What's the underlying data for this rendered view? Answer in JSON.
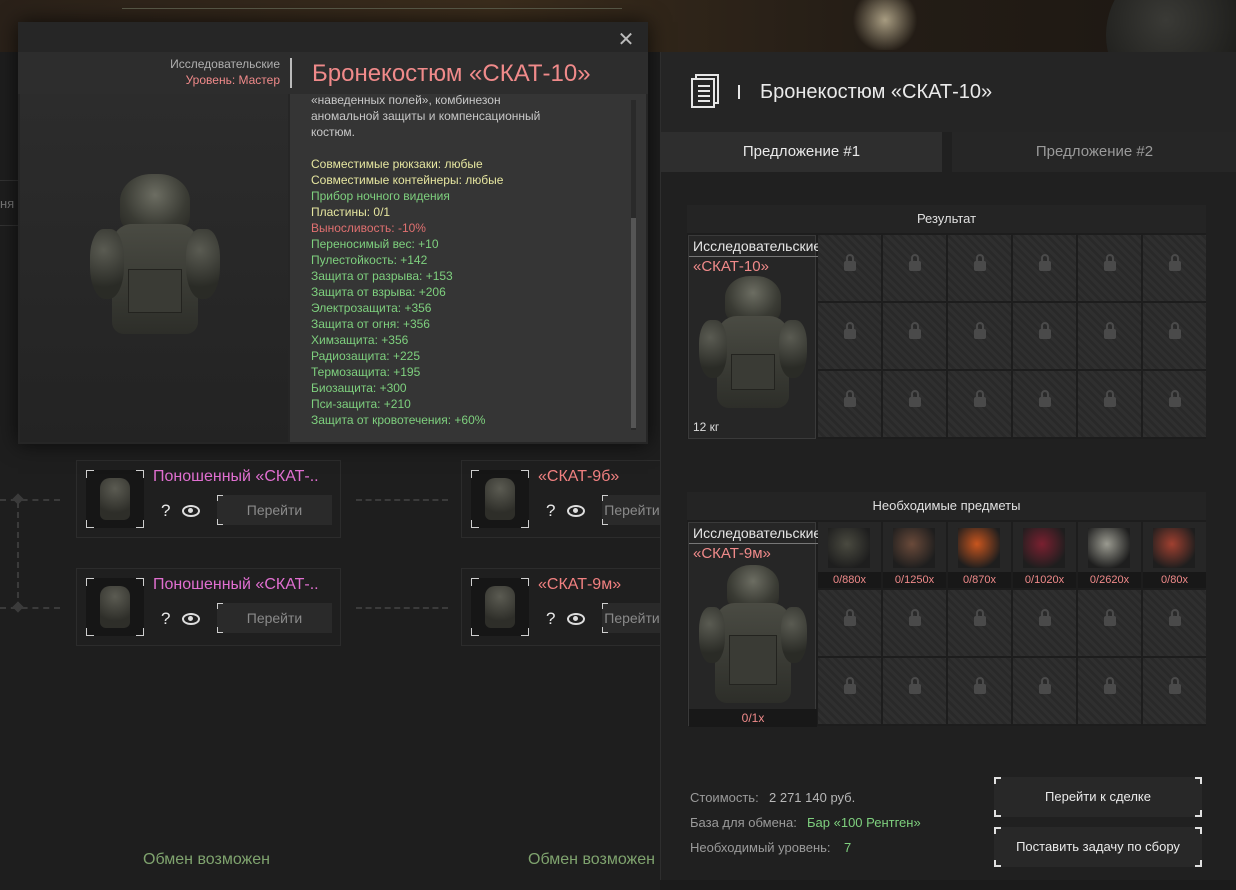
{
  "tooltip": {
    "category": "Исследовательские",
    "level": "Уровень: Мастер",
    "title": "Бронекостюм «СКАТ-10»",
    "description": [
      {
        "text": "«наведенных полей», комбинезон",
        "color": "#c8c8c8"
      },
      {
        "text": "аномальной защиты и компенсационный",
        "color": "#c8c8c8"
      },
      {
        "text": "костюм.",
        "color": "#c8c8c8"
      },
      {
        "text": "",
        "color": "#c8c8c8"
      },
      {
        "text": "Совместимые рюкзаки: любые",
        "color": "#e6e6a0"
      },
      {
        "text": "Совместимые контейнеры: любые",
        "color": "#e6e6a0"
      },
      {
        "text": "Прибор ночного видения",
        "color": "#7ed07e"
      },
      {
        "text": "Пластины: 0/1",
        "color": "#e6e6a0"
      },
      {
        "text": "Выносливость: -10%",
        "color": "#e07070"
      },
      {
        "text": "Переносимый вес: +10",
        "color": "#7ed07e"
      },
      {
        "text": "Пулестойкость: +142",
        "color": "#7ed07e"
      },
      {
        "text": "Защита от разрыва: +153",
        "color": "#7ed07e"
      },
      {
        "text": "Защита от взрыва: +206",
        "color": "#7ed07e"
      },
      {
        "text": "Электрозащита: +356",
        "color": "#7ed07e"
      },
      {
        "text": "Защита от огня: +356",
        "color": "#7ed07e"
      },
      {
        "text": "Химзащита: +356",
        "color": "#7ed07e"
      },
      {
        "text": "Радиозащита: +225",
        "color": "#7ed07e"
      },
      {
        "text": "Термозащита: +195",
        "color": "#7ed07e"
      },
      {
        "text": "Биозащита: +300",
        "color": "#7ed07e"
      },
      {
        "text": "Пси-защита: +210",
        "color": "#7ed07e"
      },
      {
        "text": "Защита от кровотечения: +60%",
        "color": "#7ed07e"
      }
    ]
  },
  "background": {
    "left_tab": "ня",
    "cards": [
      {
        "title": "Поношенный «СКАТ-..",
        "q": "?",
        "goto": "Перейти"
      },
      {
        "title": "Поношенный «СКАТ-..",
        "q": "?",
        "goto": "Перейти"
      },
      {
        "title": "«СКАТ-9б»",
        "q": "?",
        "goto": "Перейти"
      },
      {
        "title": "«СКАТ-9м»",
        "q": "?",
        "goto": "Перейти"
      }
    ],
    "exchange": [
      "Обмен возможен",
      "Обмен возможен"
    ]
  },
  "panel": {
    "title": "Бронекостюм «СКАТ-10»",
    "tabs": [
      "Предложение #1",
      "Предложение #2"
    ],
    "result": {
      "header": "Результат",
      "category": "Исследовательские",
      "name": "«СКАТ-10»",
      "weight": "12 кг"
    },
    "required": {
      "header": "Необходимые предметы",
      "category": "Исследовательские",
      "name": "«СКАТ-9м»",
      "qty": "0/1x",
      "items": [
        {
          "count": "0/880x",
          "icon": "battery-icon"
        },
        {
          "count": "0/1250x",
          "icon": "device-icon"
        },
        {
          "count": "0/870x",
          "icon": "fern-icon"
        },
        {
          "count": "0/1020x",
          "icon": "case-icon"
        },
        {
          "count": "0/2620x",
          "icon": "rock-icon"
        },
        {
          "count": "0/80x",
          "icon": "artifact-icon"
        }
      ]
    },
    "footer": {
      "cost_label": "Стоимость:",
      "cost_value": "2 271 140 руб.",
      "base_label": "База для обмена:",
      "base_value": "Бар «100 Рентген»",
      "level_label": "Необходимый уровень:",
      "level_value": "7"
    },
    "buttons": {
      "deal": "Перейти к сделке",
      "task": "Поставить задачу по сбору"
    }
  }
}
